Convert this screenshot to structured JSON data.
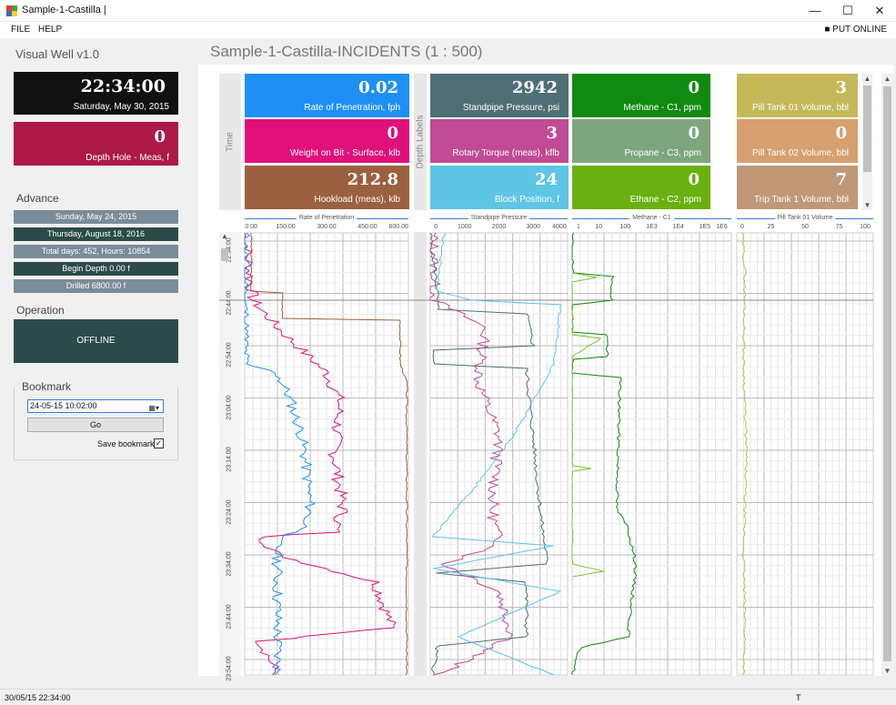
{
  "window": {
    "title": "Sample-1-Castilla |"
  },
  "menu": {
    "file": "FILE",
    "help": "HELP",
    "put_online": "PUT ONLINE"
  },
  "left": {
    "app_name": "Visual Well v1.0",
    "clock": {
      "time": "22:34:00",
      "date": "Saturday, May 30, 2015"
    },
    "depth_hole": {
      "value": "0",
      "label": "Depth Hole - Meas, f"
    },
    "advance": {
      "title": "Advance",
      "rows": [
        {
          "text": "Sunday, May 24, 2015",
          "color": "#7a8b99"
        },
        {
          "text": "Thursday, August 18, 2016",
          "color": "#2c4a4a"
        },
        {
          "text": "Total days: 452, Hours: 10854",
          "color": "#7a8b99"
        },
        {
          "text": "Begin Depth 0.00 f",
          "color": "#2c4a4a"
        },
        {
          "text": "Drilled 6800.00 f",
          "color": "#7a8b99"
        }
      ]
    },
    "operation": {
      "title": "Operation",
      "status": "OFFLINE"
    },
    "bookmark": {
      "title": "Bookmark",
      "value": "24-05-15 10:02:00",
      "go": "Go",
      "save_label": "Save bookmark",
      "checked": "✓"
    }
  },
  "main": {
    "title": "Sample-1-Castilla-INCIDENTS (1 : 500)",
    "time_label": "Time",
    "depth_label": "Depth Labels",
    "tiles": [
      [
        {
          "value": "0.02",
          "label": "Rate of Penetration, fph",
          "color": "#1e90f5"
        },
        {
          "value": "0",
          "label": "Weight on Bit - Surface, klb",
          "color": "#e0107a"
        },
        {
          "value": "212.8",
          "label": "Hookload (meas), klb",
          "color": "#9a6040"
        }
      ],
      [
        {
          "value": "2942",
          "label": "Standpipe Pressure, psi",
          "color": "#4f6e75"
        },
        {
          "value": "3",
          "label": "Rotary Torque (meas), kflb",
          "color": "#c04a94"
        },
        {
          "value": "24",
          "label": "Block Position, f",
          "color": "#5ec5e5"
        }
      ],
      [
        {
          "value": "0",
          "label": "Methane - C1, ppm",
          "color": "#108a10"
        },
        {
          "value": "0",
          "label": "Propane - C3, ppm",
          "color": "#7ea67e"
        },
        {
          "value": "0",
          "label": "Ethane - C2, ppm",
          "color": "#6ab010"
        }
      ],
      [
        {
          "value": "3",
          "label": "Pill Tank 01 Volume, bbl",
          "color": "#c4b858"
        },
        {
          "value": "0",
          "label": "Pill Tank 02 Volume, bbl",
          "color": "#d6a070"
        },
        {
          "value": "7",
          "label": "Trip Tank 1 Volume, bbl",
          "color": "#c09878"
        }
      ]
    ],
    "tracks": [
      {
        "title": "Rate of Penetration",
        "ticks": [
          "0.00",
          "150.00",
          "300.00",
          "450.00",
          "600.00"
        ]
      },
      {
        "title": "Standpipe Pressure",
        "ticks": [
          "0",
          "1000",
          "2000",
          "3000",
          "4000"
        ]
      },
      {
        "title": "Methane - C1",
        "ticks": [
          "1",
          "10",
          "100",
          "1E3",
          "1E4",
          "1E5",
          "1E6"
        ]
      },
      {
        "title": "Pill Tank 01 Volume",
        "ticks": [
          "0",
          "25",
          "50",
          "75",
          "100"
        ]
      }
    ],
    "time_labels": [
      "22:34:00",
      "22:44:00",
      "22:54:00",
      "23:04:00",
      "23:14:00",
      "23:24:00",
      "23:34:00",
      "23:44:00",
      "23:54:00",
      "00:04:00"
    ]
  },
  "status": {
    "time": "30/05/15 22:34:00",
    "mode": "T"
  }
}
